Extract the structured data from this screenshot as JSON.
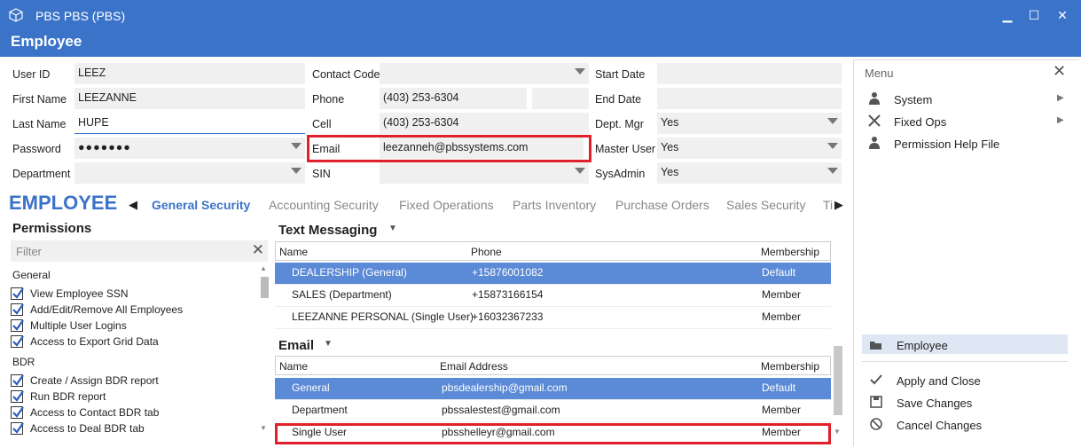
{
  "window": {
    "app_title": "PBS PBS (PBS)",
    "header": "Employee"
  },
  "form": {
    "user_id_label": "User ID",
    "user_id": "LEEZ",
    "first_name_label": "First Name",
    "first_name": "LEEZANNE",
    "last_name_label": "Last Name",
    "last_name": "HUPE",
    "password_label": "Password",
    "password": "●●●●●●●",
    "department_label": "Department",
    "department": "",
    "contact_code_label": "Contact Code",
    "contact_code": "",
    "phone_label": "Phone",
    "phone": "(403) 253-6304",
    "cell_label": "Cell",
    "cell": "(403) 253-6304",
    "email_label": "Email",
    "email": "leezanneh@pbssystems.com",
    "sin_label": "SIN",
    "sin": "",
    "start_date_label": "Start Date",
    "end_date_label": "End Date",
    "dept_mgr_label": "Dept. Mgr",
    "dept_mgr": "Yes",
    "master_user_label": "Master User",
    "master_user": "Yes",
    "sysadmin_label": "SysAdmin",
    "sysadmin": "Yes"
  },
  "tabs": {
    "section_title": "EMPLOYEE",
    "items": [
      "General Security",
      "Accounting Security",
      "Fixed Operations",
      "Parts Inventory",
      "Purchase Orders",
      "Sales Security",
      "Ti"
    ]
  },
  "permissions": {
    "title": "Permissions",
    "filter_placeholder": "Filter",
    "groups": [
      {
        "name": "General",
        "items": [
          "View Employee SSN",
          "Add/Edit/Remove All Employees",
          "Multiple User Logins",
          "Access to Export Grid Data"
        ]
      },
      {
        "name": "BDR",
        "items": [
          "Create / Assign BDR report",
          "Run BDR report",
          "Access to Contact BDR tab",
          "Access to Deal BDR tab"
        ]
      }
    ]
  },
  "text_messaging": {
    "title": "Text Messaging",
    "columns": [
      "Name",
      "Phone",
      "Membership"
    ],
    "rows": [
      [
        "DEALERSHIP (General)",
        "+15876001082",
        "Default"
      ],
      [
        "SALES (Department)",
        "+15873166154",
        "Member"
      ],
      [
        "LEEZANNE PERSONAL (Single User)",
        "+16032367233",
        "Member"
      ]
    ]
  },
  "email": {
    "title": "Email",
    "columns": [
      "Name",
      "Email Address",
      "Membership"
    ],
    "rows": [
      [
        "General",
        "pbsdealership@gmail.com",
        "Default"
      ],
      [
        "Department",
        "pbssalestest@gmail.com",
        "Member"
      ],
      [
        "Single User",
        "pbsshelleyr@gmail.com",
        "Member"
      ]
    ]
  },
  "menu": {
    "title": "Menu",
    "items": [
      "System",
      "Fixed Ops",
      "Permission Help File"
    ],
    "current": "Employee",
    "actions": [
      "Apply and Close",
      "Save Changes",
      "Cancel Changes"
    ]
  },
  "colors": {
    "accent": "#3b73c9",
    "selected_row": "#5b8ad6",
    "highlight": "#e0202a"
  }
}
